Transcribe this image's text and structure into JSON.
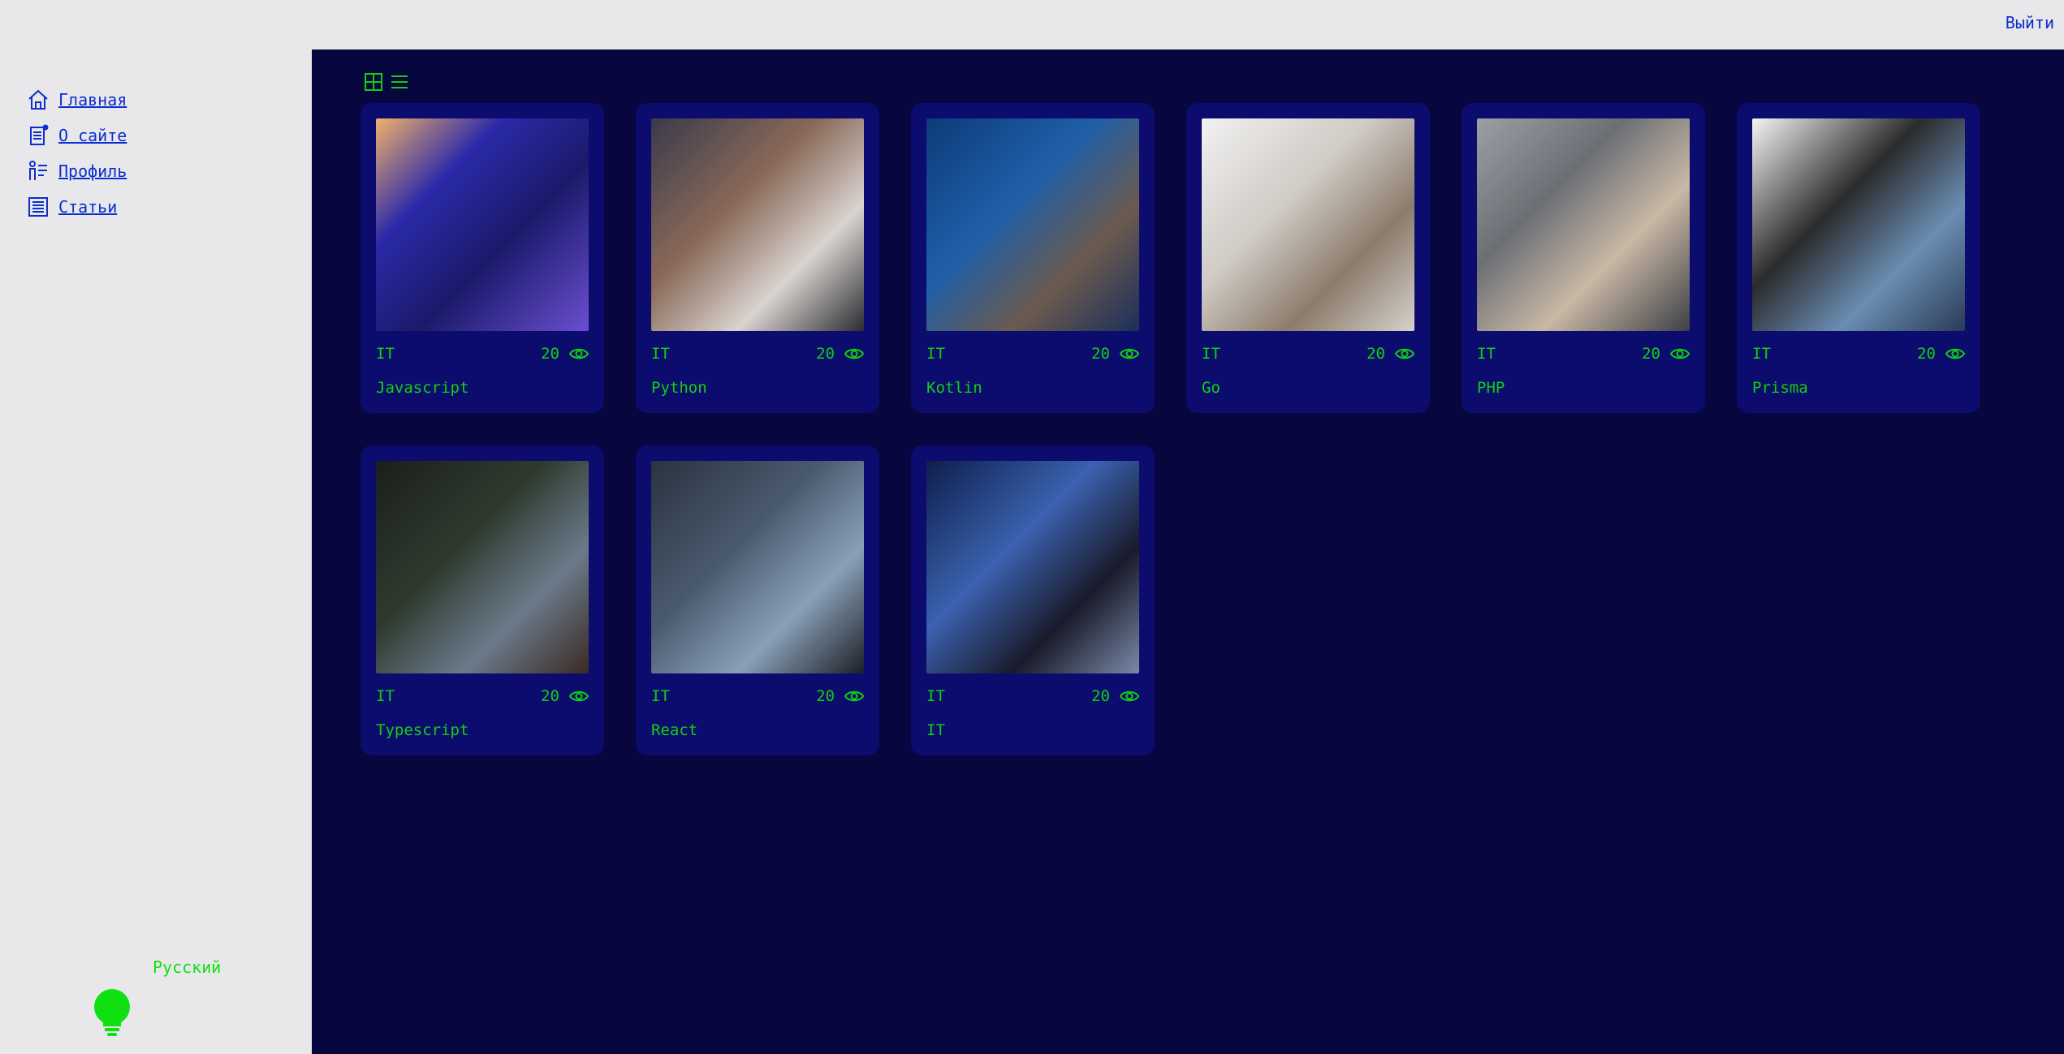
{
  "header": {
    "logout_label": "Выйти"
  },
  "sidebar": {
    "items": [
      {
        "label": "Главная",
        "icon": "home-icon"
      },
      {
        "label": "О сайте",
        "icon": "document-icon"
      },
      {
        "label": "Профиль",
        "icon": "profile-list-icon"
      },
      {
        "label": "Статьи",
        "icon": "articles-icon"
      }
    ],
    "language_label": "Русский",
    "theme_icon": "lightbulb-icon"
  },
  "colors": {
    "accent": "#10d010",
    "link": "#0b2ecf",
    "main_bg": "#07063f",
    "card_bg": "#0c0c6e"
  },
  "articles": [
    {
      "category": "IT",
      "views": "20",
      "title": "Javascript"
    },
    {
      "category": "IT",
      "views": "20",
      "title": "Python"
    },
    {
      "category": "IT",
      "views": "20",
      "title": "Kotlin"
    },
    {
      "category": "IT",
      "views": "20",
      "title": "Go"
    },
    {
      "category": "IT",
      "views": "20",
      "title": "PHP"
    },
    {
      "category": "IT",
      "views": "20",
      "title": "Prisma"
    },
    {
      "category": "IT",
      "views": "20",
      "title": "Typescript"
    },
    {
      "category": "IT",
      "views": "20",
      "title": "React"
    },
    {
      "category": "IT",
      "views": "20",
      "title": "IT"
    }
  ]
}
